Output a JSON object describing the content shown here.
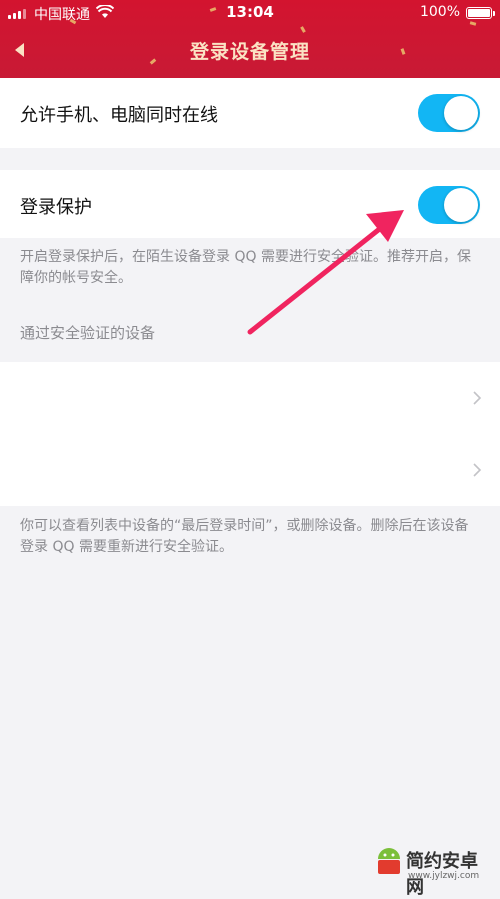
{
  "status_bar": {
    "carrier": "中国联通",
    "time": "13:04",
    "battery_percent": "100%"
  },
  "header": {
    "title": "登录设备管理",
    "back_icon": "chevron-left-icon",
    "background": "#cf1631",
    "title_color": "#fbe2c4"
  },
  "settings": {
    "allow_online_label": "允许手机、电脑同时在线",
    "allow_online_enabled": true,
    "login_protection_label": "登录保护",
    "login_protection_enabled": true,
    "toggle_color": "#12b6f4",
    "protection_description": "开启登录保护后，在陌生设备登录 QQ 需要进行安全验证。推荐开启，保障你的帐号安全。"
  },
  "verified_devices": {
    "section_title": "通过安全验证的设备",
    "device_rows": 2,
    "footer_note": "你可以查看列表中设备的“最后登录时间”，或删除设备。删除后在该设备登录 QQ 需要重新进行安全验证。"
  },
  "watermark": {
    "name": "简约安卓网",
    "url": "www.jylzwj.com"
  }
}
